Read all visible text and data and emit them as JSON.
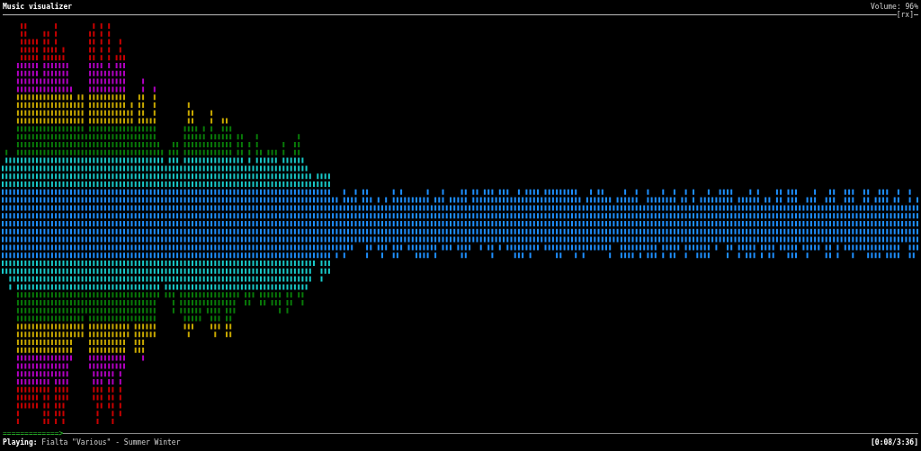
{
  "header": {
    "title": "Music visualizer",
    "volume": "Volume: 96%",
    "visualizer_type": "[rx]"
  },
  "footer": {
    "progress": "=============>",
    "status_label": "Playing:",
    "track": "Fialta \"Various\" - Summer Winter",
    "time": "[0:08/3:36]"
  }
}
